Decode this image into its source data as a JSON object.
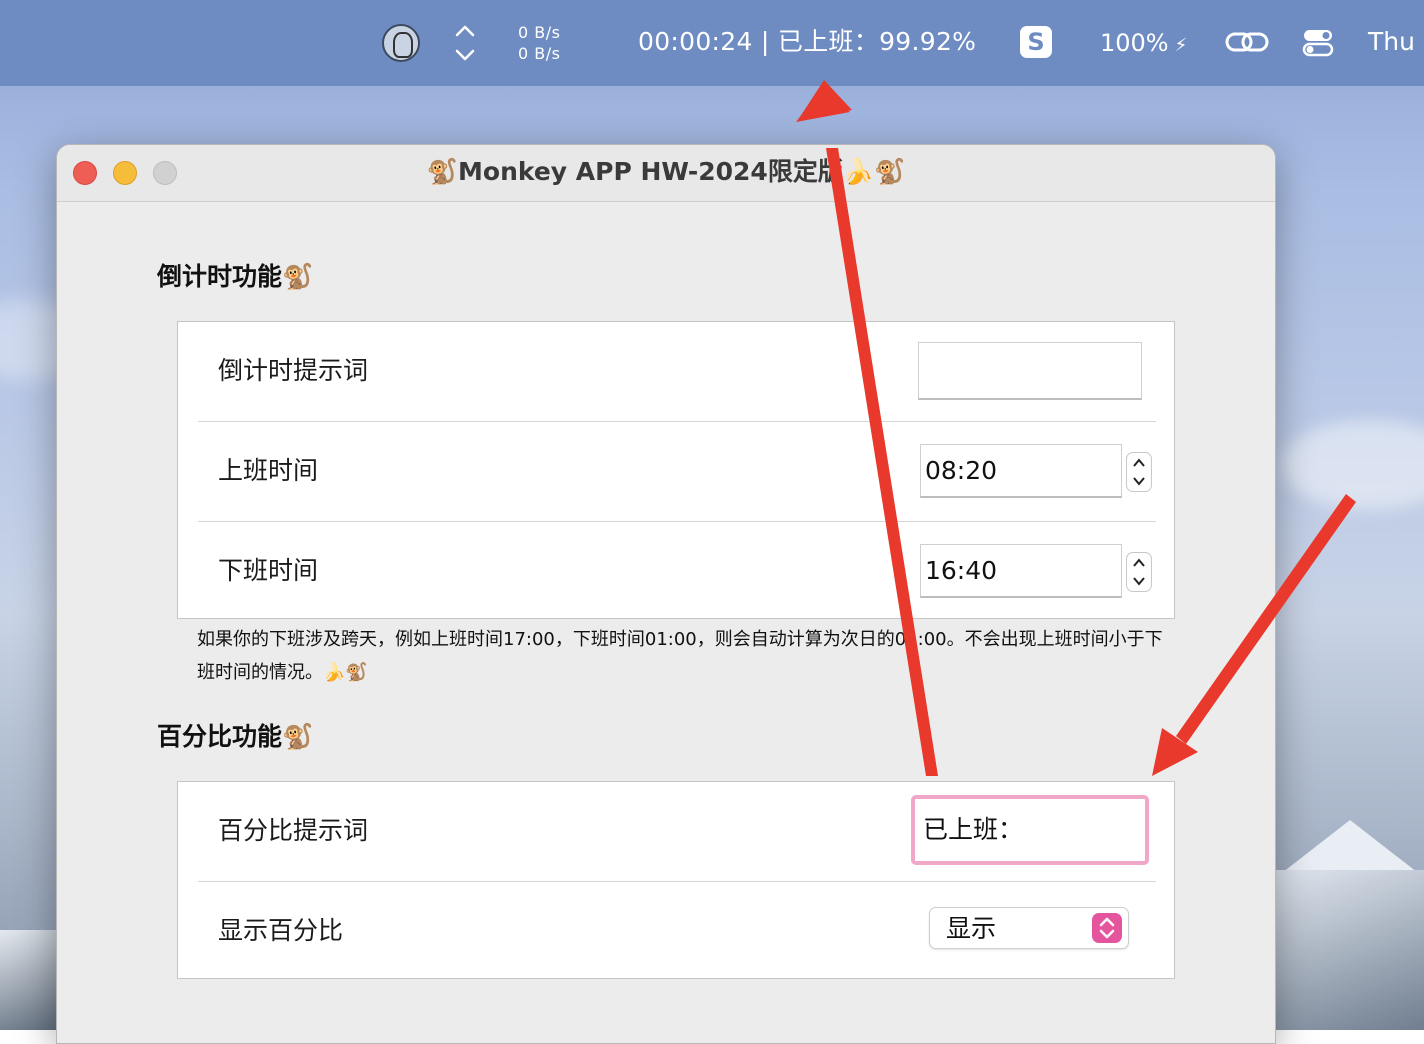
{
  "menubar": {
    "net_up": "0 B/s",
    "net_down": "0 B/s",
    "status": "00:00:24 | 已上班：99.92%",
    "battery": "100%",
    "date": "Thu"
  },
  "window": {
    "title": "🐒Monkey APP HW-2024限定版🍌🐒"
  },
  "countdown": {
    "title": "倒计时功能🐒",
    "prompt_label": "倒计时提示词",
    "prompt_value": "",
    "start_label": "上班时间",
    "start_value": "08:20",
    "end_label": "下班时间",
    "end_value": "16:40",
    "note": "如果你的下班涉及跨天，例如上班时间17:00，下班时间01:00，则会自动计算为次日的01:00。不会出现上班时间小于下班时间的情况。🍌🐒"
  },
  "percent": {
    "title": "百分比功能🐒",
    "prompt_label": "百分比提示词",
    "prompt_value": "已上班：",
    "show_label": "显示百分比",
    "show_value": "显示"
  },
  "colors": {
    "menubar": "#6f8cc2",
    "arrow": "#e8392c",
    "focus_ring": "#f0a7c8",
    "popup_accent": "#e4559d"
  }
}
